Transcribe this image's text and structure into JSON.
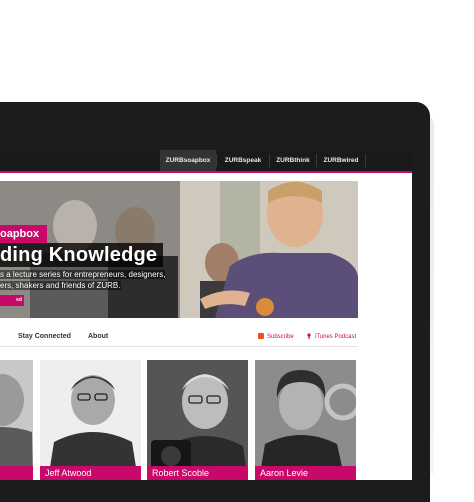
{
  "topnav": {
    "items": [
      {
        "label": "ZURBsoapbox",
        "active": true
      },
      {
        "label": "ZURBspeak",
        "active": false
      },
      {
        "label": "ZURBthink",
        "active": false
      },
      {
        "label": "ZURBwired",
        "active": false
      }
    ]
  },
  "hero": {
    "tag": "oapbox",
    "title": "ding Knowledge",
    "description_line1": "s a lecture series for entrepreneurs, designers,",
    "description_line2": "ers, shakers and friends of ZURB.",
    "button": "ed"
  },
  "subnav": {
    "links": [
      "Stay Connected",
      "About"
    ],
    "subscribe": "Subscribe",
    "podcast": "iTunes Podcast"
  },
  "speakers": [
    {
      "name": ""
    },
    {
      "name": "Jeff Atwood"
    },
    {
      "name": "Robert Scoble"
    },
    {
      "name": "Aaron Levie"
    }
  ],
  "colors": {
    "accent": "#c8096a",
    "nav_bg": "#1a1a1a",
    "frame": "#1c1c1c"
  }
}
